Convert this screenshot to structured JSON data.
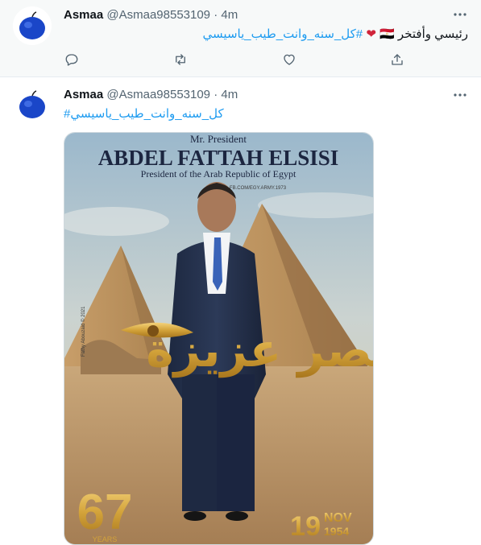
{
  "colors": {
    "accent": "#1d9bf0",
    "muted": "#536471",
    "gold": "#d3a33a"
  },
  "tweets": [
    {
      "name": "Asmaa",
      "handle": "@Asmaa98553109",
      "separator": "·",
      "time": "4m",
      "text_plain": "رئيسي وأفتخر",
      "emoji_flag": "🇪🇬",
      "emoji_heart": "❤",
      "hashtag": "#كل_سنه_وانت_طيب_ياسيسي",
      "avatar_icon": "blue-apple-icon"
    },
    {
      "name": "Asmaa",
      "handle": "@Asmaa98553109",
      "separator": "·",
      "time": "4m",
      "hashtag": "#كل_سنه_وانت_طيب_ياسيسي",
      "avatar_icon": "blue-apple-icon"
    }
  ],
  "actions": [
    "reply-icon",
    "retweet-icon",
    "like-icon",
    "share-icon"
  ],
  "poster": {
    "subtitle_top": "Mr. President",
    "title": "ABDEL FATTAH ELSISI",
    "subtitle": "President of the Arab Republic of Egypt",
    "watermark": "FB.COM/EGY.ARMY.1973",
    "credit": "Fathy Abouzaid © 2021",
    "calligraphy": "مصر عزيزة",
    "age_number": "67",
    "age_label": "YEARS",
    "date_day": "19",
    "date_month": "NOV",
    "date_year": "1954"
  }
}
